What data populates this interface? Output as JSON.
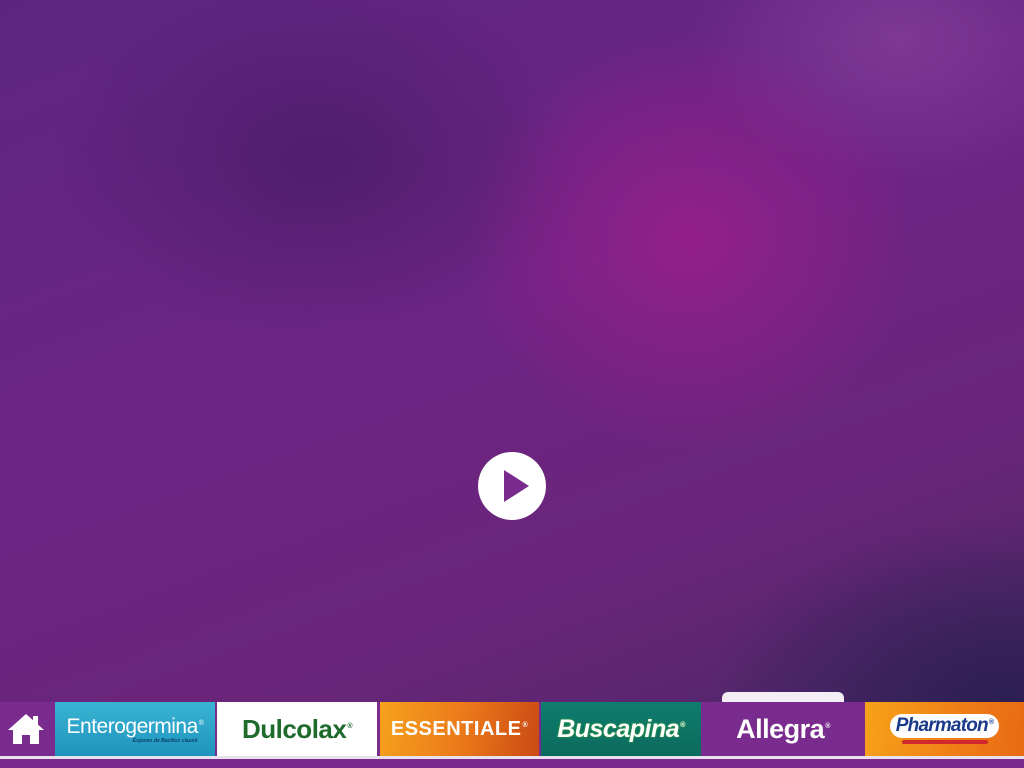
{
  "player": {
    "play_icon": "play-icon",
    "accent": "#ffffff"
  },
  "navbar": {
    "home_icon": "home-icon",
    "background": "#7a2b8e",
    "brands": [
      {
        "id": "enterogermina",
        "label": "Enterogermina",
        "sub": "Esporas de Bacillus clausii",
        "color": "#2aa3c8"
      },
      {
        "id": "dulcolax",
        "label": "Dulcolax",
        "color": "#1f6b2c"
      },
      {
        "id": "essentiale",
        "label": "ESSENTIALE",
        "color": "#ec7b1a"
      },
      {
        "id": "buscapina",
        "label": "Buscapina",
        "color": "#0b6a5d"
      },
      {
        "id": "allegra",
        "label": "Allegra",
        "color": "#7a2b8e",
        "active": true
      },
      {
        "id": "pharmaton",
        "label": "Pharmaton",
        "color": "#ef7d16"
      }
    ]
  },
  "registered_mark": "®"
}
